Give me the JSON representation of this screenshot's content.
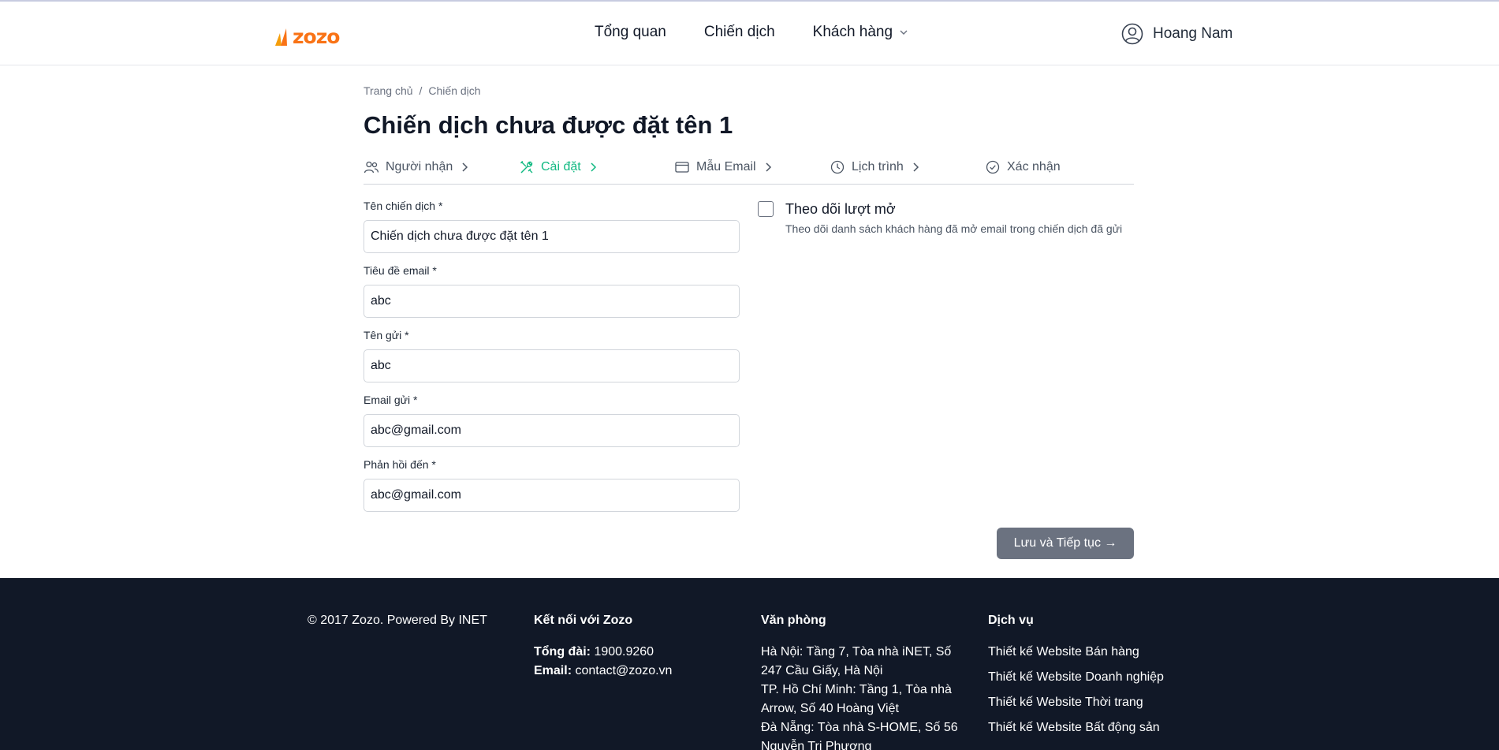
{
  "header": {
    "logo_text": "zozo",
    "nav": [
      {
        "label": "Tổng quan"
      },
      {
        "label": "Chiến dịch"
      },
      {
        "label": "Khách hàng"
      }
    ],
    "user_name": "Hoang Nam"
  },
  "breadcrumb": {
    "home": "Trang chủ",
    "separator": "/",
    "current": "Chiến dịch"
  },
  "page_title": "Chiến dịch chưa được đặt tên 1",
  "steps": [
    {
      "label": "Người nhận",
      "icon": "users-icon",
      "active": false
    },
    {
      "label": "Cài đặt",
      "icon": "tools-icon",
      "active": true
    },
    {
      "label": "Mẫu Email",
      "icon": "window-icon",
      "active": false
    },
    {
      "label": "Lịch trình",
      "icon": "clock-icon",
      "active": false
    },
    {
      "label": "Xác nhận",
      "icon": "check-circle-icon",
      "active": false
    }
  ],
  "form": {
    "campaign_name": {
      "label": "Tên chiến dịch *",
      "value": "Chiến dịch chưa được đặt tên 1"
    },
    "email_subject": {
      "label": "Tiêu đề email *",
      "value": "abc"
    },
    "sender_name": {
      "label": "Tên gửi *",
      "value": "abc"
    },
    "sender_email": {
      "label": "Email gửi *",
      "value": "abc@gmail.com"
    },
    "reply_to": {
      "label": "Phản hồi đến *",
      "value": "abc@gmail.com"
    }
  },
  "tracking": {
    "title": "Theo dõi lượt mở",
    "description": "Theo dõi danh sách khách hàng đã mở email trong chiến dịch đã gửi",
    "checked": false
  },
  "save_button": "Lưu và Tiếp tục →",
  "footer": {
    "copyright": "© 2017 Zozo. Powered By INET",
    "connect": {
      "heading": "Kết nối với Zozo",
      "phone_label": "Tổng đài:",
      "phone": "1900.9260",
      "email_label": "Email:",
      "email": "contact@zozo.vn"
    },
    "office": {
      "heading": "Văn phòng",
      "lines": [
        "Hà Nội: Tầng 7, Tòa nhà iNET, Số",
        "247 Cầu Giấy, Hà Nội",
        "TP. Hồ Chí Minh: Tầng 1, Tòa nhà",
        "Arrow, Số 40 Hoàng Việt",
        "Đà Nẵng: Tòa nhà S-HOME, Số 56",
        "Nguyễn Tri Phương"
      ]
    },
    "services": {
      "heading": "Dịch vụ",
      "links": [
        "Thiết kế Website Bán hàng",
        "Thiết kế Website Doanh nghiệp",
        "Thiết kế Website Thời trang",
        "Thiết kế Website Bất động sản"
      ]
    }
  },
  "colors": {
    "accent": "#10b981",
    "brand": "#f97316",
    "footer_bg": "#111827",
    "button_bg": "#6b7280"
  }
}
